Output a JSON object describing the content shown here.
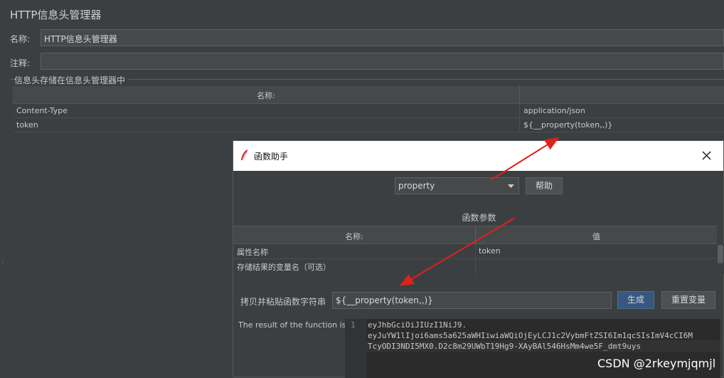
{
  "main": {
    "title": "HTTP信息头管理器",
    "name_label": "名称:",
    "name_value": "HTTP信息头管理器",
    "comment_label": "注释:",
    "comment_value": "",
    "group_label": "信息头存储在信息头管理器中",
    "table": {
      "headers": [
        "名称:",
        ""
      ],
      "rows": [
        {
          "name": "Content-Type",
          "value": "application/json"
        },
        {
          "name": "token",
          "value": "${__property(token,,)}"
        }
      ]
    }
  },
  "dialog": {
    "title": "函数助手",
    "close_icon": "close-icon",
    "function_select": "property",
    "help_button": "帮助",
    "params_label": "函数参数",
    "params_table": {
      "headers": [
        "名称:",
        "值"
      ],
      "rows": [
        {
          "name": "属性名称",
          "value": "token"
        },
        {
          "name": "存储结果的变量名（可选）",
          "value": ""
        }
      ]
    },
    "copy_label": "拷贝并粘贴函数字符串",
    "function_string": "${__property(token,,)}",
    "generate_button": "生成",
    "reset_button": "重置变量",
    "result_label": "The result of the function is",
    "result_line_number": "1",
    "result_lines": [
      "eyJhbGciOiJIUzI1NiJ9.",
      "eyJuYW1lIjoi6ams5a625aWHIiwiaWQiOjEyLCJ1c2VybmFtZSI6Im1qcSIsImV4cCI6M",
      "TcyODI3NDI5MX0.D2c8m29UWbT19Hg9-XAyBAl546HsMm4we5F_dmt9uys"
    ]
  },
  "watermark": "CSDN @2rkeymjqmjl",
  "colors": {
    "annotation_arrow": "#e0201b",
    "primary_button": "#365880"
  }
}
